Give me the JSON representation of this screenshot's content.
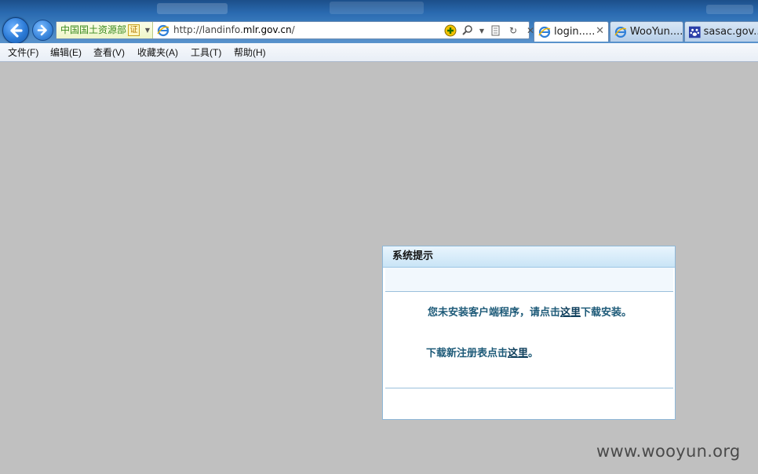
{
  "browser": {
    "site_identity": "中国国土资源部",
    "cert_badge": "证",
    "url_host_prefix": "http://landinfo.",
    "url_host_domain": "mlr.gov.cn",
    "url_path": "/",
    "tabs": [
      {
        "label": "login.....",
        "active": true,
        "icon": "ie-page-icon"
      },
      {
        "label": "WooYun....",
        "active": false,
        "icon": "ie-page-icon"
      },
      {
        "label": "sasac.gov...",
        "active": false,
        "icon": "baidu-paw-icon"
      }
    ]
  },
  "menu": {
    "items": [
      "文件(F)",
      "编辑(E)",
      "查看(V)",
      "收藏夹(A)",
      "工具(T)",
      "帮助(H)"
    ]
  },
  "dialog": {
    "title": "系统提示",
    "line1_before": "您未安装客户端程序，请点击",
    "line1_link": "这里",
    "line1_after": "下载安装。",
    "line2_before": "下载新注册表点击",
    "line2_link": "这里",
    "line2_after": "。"
  },
  "watermark": "www.wooyun.org",
  "colors": {
    "page_background": "#c0c0c0",
    "dialog_text": "#1d5a78",
    "site_identity_green": "#3b8a1f"
  }
}
